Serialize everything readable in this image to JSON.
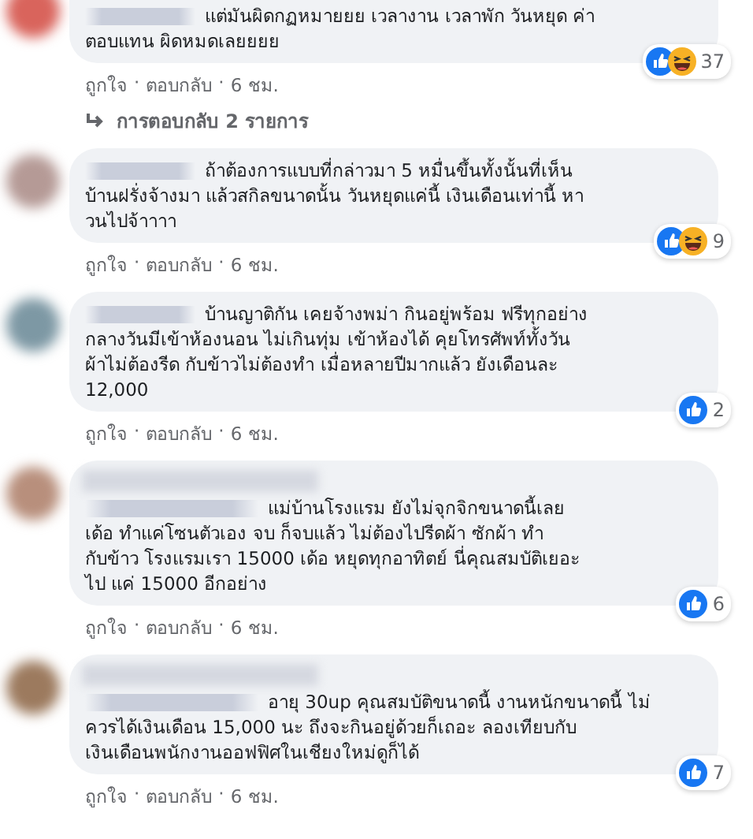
{
  "comments": [
    {
      "name_on_own_line": false,
      "text": "แต่มันผิดกฏหมายยย เวลางาน เวลาพัก วันหยุด ค่า\nตอบแทน ผิดหมดเลยยยย",
      "laugh_reaction": true,
      "reaction_count": "37",
      "actions": [
        "ถูกใจ",
        "ตอบกลับ",
        "6 ชม."
      ],
      "replies": "การตอบกลับ 2 รายการ"
    },
    {
      "name_on_own_line": false,
      "text": "ถ้าต้องการแบบที่กล่าวมา 5 หมื่นขึ้นทั้งนั้นที่เห็น\nบ้านฝรั่งจ้างมา แล้วสกิลขนาดนั้น วันหยุดแค่นี้ เงินเดือนเท่านี้ หา\nวนไปจ้าาาา",
      "laugh_reaction": true,
      "reaction_count": "9",
      "actions": [
        "ถูกใจ",
        "ตอบกลับ",
        "6 ชม."
      ]
    },
    {
      "name_on_own_line": false,
      "text": "บ้านญาติกัน เคยจ้างพม่า กินอยู่พร้อม ฟรีทุกอย่าง\nกลางวันมีเข้าห้องนอน ไม่เกินทุ่ม เข้าห้องได้ คุยโทรศัพท์ทั้งวัน\nผ้าไม่ต้องรีด กับข้าวไม่ต้องทำ เมื่อหลายปีมากแล้ว ยังเดือนละ\n12,000",
      "laugh_reaction": false,
      "reaction_count": "2",
      "actions": [
        "ถูกใจ",
        "ตอบกลับ",
        "6 ชม."
      ]
    },
    {
      "name_on_own_line": true,
      "text": "แม่บ้านโรงแรม ยังไม่จุกจิกขนาดนี้เลย\nเด้อ ทำแค่โซนตัวเอง จบ ก็จบแล้ว ไม่ต้องไปรีดผ้า ซักผ้า ทำ\nกับข้าว โรงแรมเรา 15000 เด้อ หยุดทุกอาทิตย์ นี่คุณสมบัติเยอะ\nไป แค่ 15000 อีกอย่าง",
      "laugh_reaction": false,
      "reaction_count": "6",
      "actions": [
        "ถูกใจ",
        "ตอบกลับ",
        "6 ชม."
      ]
    },
    {
      "name_on_own_line": true,
      "text": "อายุ 30up คุณสมบัติขนาดนี้ งานหนักขนาดนี้ ไม่\nควรได้เงินเดือน 15,000 นะ ถึงจะกินอยู่ด้วยก็เถอะ ลองเทียบกับ\nเงินเดือนพนักงานออฟฟิศในเชียงใหม่ดูก็ได้",
      "laugh_reaction": false,
      "reaction_count": "7",
      "actions": [
        "ถูกใจ",
        "ตอบกลับ",
        "6 ชม."
      ]
    }
  ],
  "separator": "·"
}
